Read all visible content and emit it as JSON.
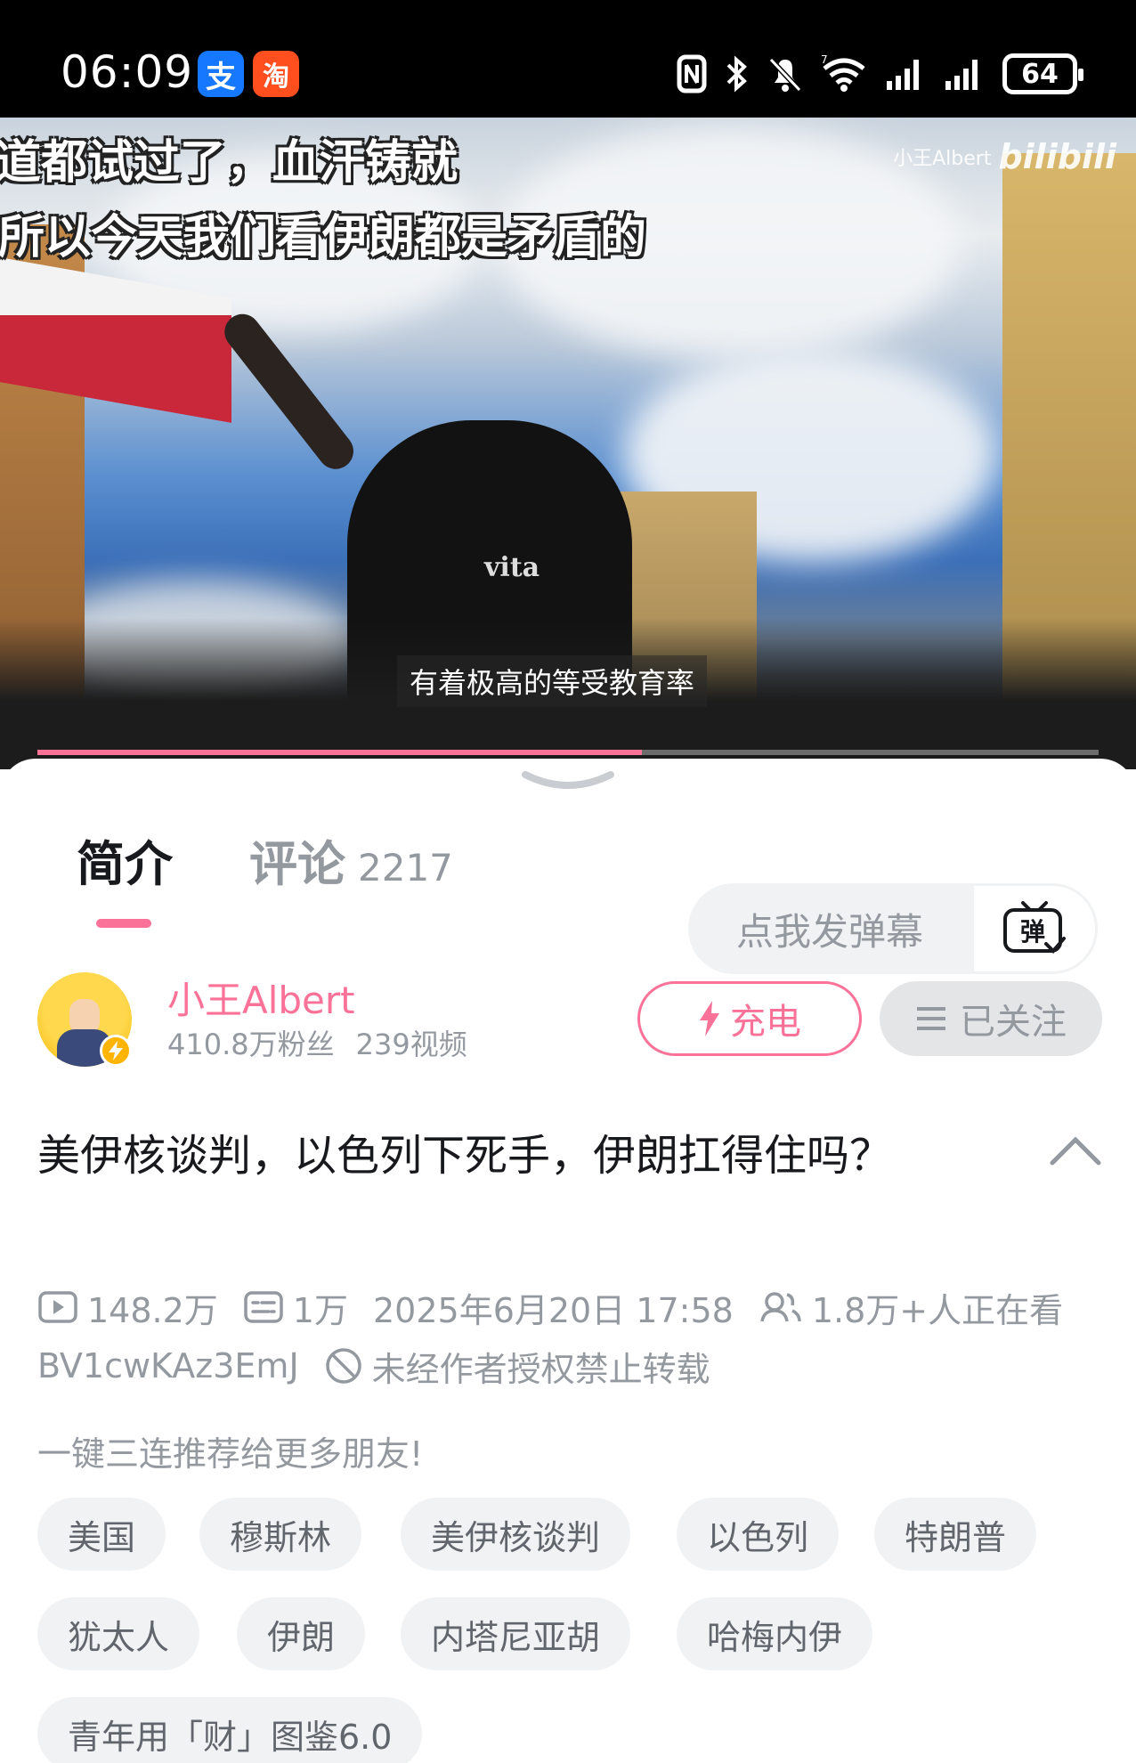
{
  "status_bar": {
    "time": "06:09",
    "apps": [
      {
        "icon": "alipay-icon",
        "glyph": "支"
      },
      {
        "icon": "taobao-icon",
        "glyph": "淘"
      }
    ],
    "battery": "64"
  },
  "video": {
    "caption_lines": [
      "道都试过了，血汗铸就",
      "所以今天我们看伊朗都是矛盾的"
    ],
    "watermark_author": "小王Albert",
    "watermark_brand": "bilibili",
    "subtitle": "有着极高的等受教育率",
    "shirt_text": "vita",
    "progress": 0.57
  },
  "tabs": {
    "intro": "简介",
    "comments": "评论",
    "comments_count": "2217",
    "danmaku_placeholder": "点我发弹幕",
    "danmaku_button": "弹"
  },
  "uploader": {
    "name": "小王Albert",
    "fans": "410.8万粉丝",
    "videos": "239视频",
    "charge_label": "充电",
    "follow_label": "已关注"
  },
  "video_info": {
    "title": "美伊核谈判，以色列下死手，伊朗扛得住吗？",
    "views": "148.2万",
    "danmaku_count": "1万",
    "published": "2025年6月20日 17:58",
    "watching": "1.8万+人正在看",
    "bvid": "BV1cwKAz3EmJ",
    "copyright": "未经作者授权禁止转载",
    "tagline": "一键三连推荐给更多朋友!"
  },
  "tags": [
    "美国",
    "穆斯林",
    "美伊核谈判",
    "以色列",
    "特朗普",
    "犹太人",
    "伊朗",
    "内塔尼亚胡",
    "哈梅内伊",
    "青年用「财」图鉴6.0"
  ],
  "colors": {
    "accent": "#fb7299",
    "muted_text": "#9499a0",
    "chip_bg": "#f1f2f3"
  }
}
